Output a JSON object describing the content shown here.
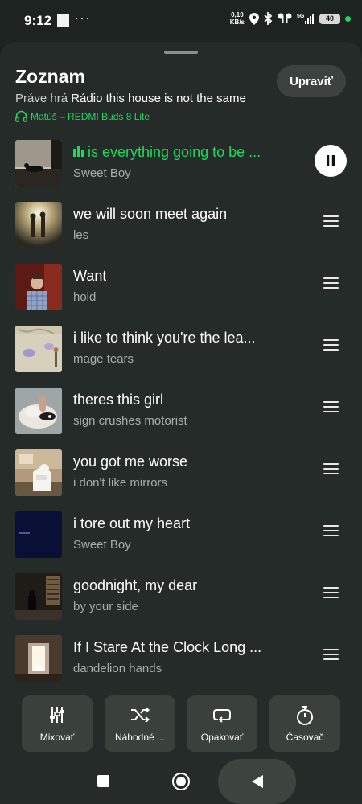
{
  "status_bar": {
    "time": "9:12",
    "more": "···",
    "net_speed": "0,10",
    "net_unit": "KB/s",
    "signal_type": "5G",
    "battery": "40"
  },
  "sheet": {
    "title": "Zoznam",
    "edit_label": "Upraviť",
    "now_playing_prefix": "Práve hrá",
    "now_playing_source": "Rádio this house is not the same",
    "device": "Matúš – REDMI Buds 8 Lite"
  },
  "tracks": [
    {
      "title": "is everything going to be ...",
      "artist": "Sweet Boy",
      "playing": true
    },
    {
      "title": "we will soon meet again",
      "artist": "les"
    },
    {
      "title": "Want",
      "artist": "hold"
    },
    {
      "title": "i like to think you're the lea...",
      "artist": "mage tears"
    },
    {
      "title": "theres this girl",
      "artist": "sign crushes motorist"
    },
    {
      "title": "you got me worse",
      "artist": "i don't like mirrors"
    },
    {
      "title": "i tore out my heart",
      "artist": "Sweet Boy"
    },
    {
      "title": "goodnight, my dear",
      "artist": "by your side"
    },
    {
      "title": "If I Stare At the Clock Long ...",
      "artist": "dandelion hands"
    }
  ],
  "controls": [
    {
      "label": "Mixovať",
      "icon": "mix-sliders-icon"
    },
    {
      "label": "Náhodné ...",
      "icon": "shuffle-icon"
    },
    {
      "label": "Opakovať",
      "icon": "repeat-icon"
    },
    {
      "label": "Časovač",
      "icon": "timer-icon"
    }
  ],
  "colors": {
    "accent": "#1ed760",
    "background": "#252b28",
    "button": "#3a413d"
  }
}
